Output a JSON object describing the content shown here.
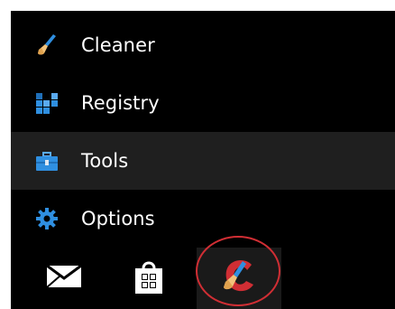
{
  "menu": {
    "items": [
      {
        "label": "Cleaner",
        "icon": "broom-icon"
      },
      {
        "label": "Registry",
        "icon": "registry-blocks-icon"
      },
      {
        "label": "Tools",
        "icon": "toolbox-icon",
        "active": true
      },
      {
        "label": "Options",
        "icon": "gear-icon"
      }
    ]
  },
  "taskbar": {
    "items": [
      {
        "icon": "mail-icon"
      },
      {
        "icon": "store-bag-icon"
      },
      {
        "icon": "ccleaner-app-icon",
        "highlighted": true
      }
    ]
  },
  "colors": {
    "background": "#000000",
    "active_row": "#1f1f1f",
    "text": "#ffffff",
    "accent_blue": "#2f8fe0",
    "highlight_ring": "#d02e34"
  }
}
